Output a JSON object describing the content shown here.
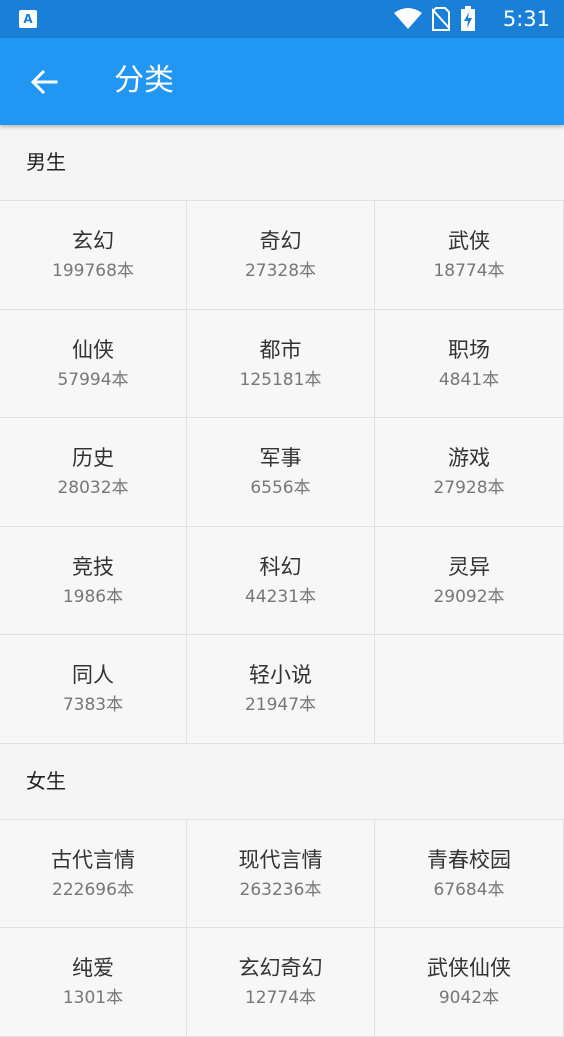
{
  "status_bar": {
    "time": "5:31",
    "app_badge": "A",
    "icons": [
      "wifi-icon",
      "no-sim-icon",
      "battery-charging-icon"
    ]
  },
  "app_bar": {
    "back_icon": "arrow-left-icon",
    "title": "分类"
  },
  "sections": [
    {
      "title": "男生",
      "items": [
        {
          "name": "玄幻",
          "count": "199768本"
        },
        {
          "name": "奇幻",
          "count": "27328本"
        },
        {
          "name": "武侠",
          "count": "18774本"
        },
        {
          "name": "仙侠",
          "count": "57994本"
        },
        {
          "name": "都市",
          "count": "125181本"
        },
        {
          "name": "职场",
          "count": "4841本"
        },
        {
          "name": "历史",
          "count": "28032本"
        },
        {
          "name": "军事",
          "count": "6556本"
        },
        {
          "name": "游戏",
          "count": "27928本"
        },
        {
          "name": "竞技",
          "count": "1986本"
        },
        {
          "name": "科幻",
          "count": "44231本"
        },
        {
          "name": "灵异",
          "count": "29092本"
        },
        {
          "name": "同人",
          "count": "7383本"
        },
        {
          "name": "轻小说",
          "count": "21947本"
        }
      ]
    },
    {
      "title": "女生",
      "items": [
        {
          "name": "古代言情",
          "count": "222696本"
        },
        {
          "name": "现代言情",
          "count": "263236本"
        },
        {
          "name": "青春校园",
          "count": "67684本"
        },
        {
          "name": "纯爱",
          "count": "1301本"
        },
        {
          "name": "玄幻奇幻",
          "count": "12774本"
        },
        {
          "name": "武侠仙侠",
          "count": "9042本"
        }
      ]
    }
  ]
}
